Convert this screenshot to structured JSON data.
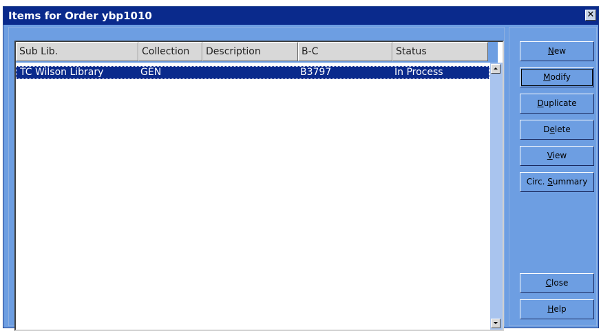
{
  "window": {
    "title": "Items for Order ybp1010",
    "close_glyph": "✕"
  },
  "table": {
    "columns": [
      "Sub Lib.",
      "Collection",
      "Description",
      "B-C",
      "Status"
    ],
    "rows": [
      {
        "sub_lib": "TC Wilson Library",
        "collection": "GEN",
        "description": "",
        "barcode": "B3797",
        "status": "In Process"
      }
    ]
  },
  "buttons": {
    "new": {
      "pre": "",
      "key": "N",
      "post": "ew"
    },
    "modify": {
      "pre": "",
      "key": "M",
      "post": "odify"
    },
    "duplicate": {
      "pre": "",
      "key": "D",
      "post": "uplicate"
    },
    "delete": {
      "pre": "D",
      "key": "e",
      "post": "lete"
    },
    "view": {
      "pre": "",
      "key": "V",
      "post": "iew"
    },
    "circ_summary": {
      "pre": "Circ. ",
      "key": "S",
      "post": "ummary"
    },
    "close": {
      "pre": "",
      "key": "C",
      "post": "lose"
    },
    "help": {
      "pre": "",
      "key": "H",
      "post": "elp"
    }
  },
  "colors": {
    "window_bg": "#6d9ee2",
    "titlebar": "#0a2a8c",
    "selection": "#0a2a8c",
    "scrollbar": "#a9c4ee"
  }
}
